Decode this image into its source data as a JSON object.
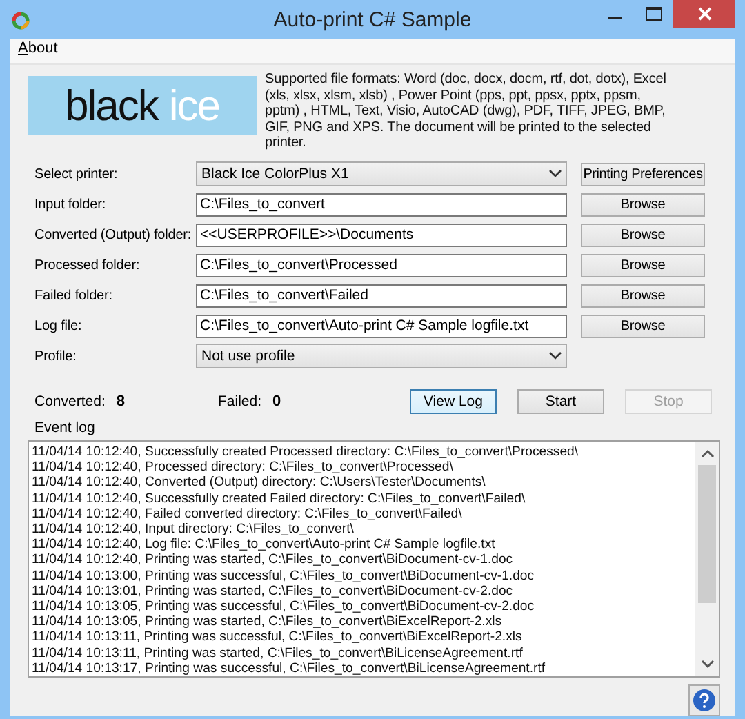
{
  "window": {
    "title": "Auto-print C# Sample"
  },
  "menu": [
    {
      "label": "About"
    }
  ],
  "logo": {
    "words": [
      "black",
      "ice"
    ]
  },
  "description": "Supported file formats: Word (doc, docx, docm, rtf, dot, dotx), Excel (xls, xlsx, xlsm, xlsb) , Power Point (pps, ppt, ppsx, pptx, ppsm, pptm) , HTML, Text, Visio, AutoCAD (dwg), PDF,  TIFF, JPEG, BMP, GIF, PNG and XPS. The document will be printed to the selected printer.",
  "fields": [
    {
      "kind": "dropdown",
      "label": "Select printer:",
      "value": "Black Ice ColorPlus X1",
      "button": "Printing Preferences"
    },
    {
      "kind": "text",
      "label": "Input folder:",
      "value": "C:\\Files_to_convert",
      "button": "Browse"
    },
    {
      "kind": "text",
      "label": "Converted (Output) folder:",
      "value": "<<USERPROFILE>>\\Documents",
      "button": "Browse"
    },
    {
      "kind": "text",
      "label": "Processed folder:",
      "value": "C:\\Files_to_convert\\Processed",
      "button": "Browse"
    },
    {
      "kind": "text",
      "label": "Failed folder:",
      "value": "C:\\Files_to_convert\\Failed",
      "button": "Browse"
    },
    {
      "kind": "text",
      "label": "Log file:",
      "value": "C:\\Files_to_convert\\Auto-print C# Sample logfile.txt",
      "button": "Browse"
    },
    {
      "kind": "dropdown",
      "label": "Profile:",
      "value": "Not use profile"
    }
  ],
  "stats": [
    {
      "label": "Converted:",
      "value": "8"
    },
    {
      "label": "Failed:",
      "value": "0"
    }
  ],
  "actions": [
    {
      "label": "View Log",
      "disabled": false,
      "focused": true
    },
    {
      "label": "Start",
      "disabled": false,
      "focused": false
    },
    {
      "label": "Stop",
      "disabled": true,
      "focused": false
    }
  ],
  "event_log": {
    "label": "Event log",
    "lines": [
      "11/04/14 10:12:40, Successfully created Processed directory: C:\\Files_to_convert\\Processed\\",
      "11/04/14 10:12:40, Processed directory: C:\\Files_to_convert\\Processed\\",
      "11/04/14 10:12:40, Converted (Output) directory: C:\\Users\\Tester\\Documents\\",
      "11/04/14 10:12:40, Successfully created Failed directory: C:\\Files_to_convert\\Failed\\",
      "11/04/14 10:12:40, Failed converted directory: C:\\Files_to_convert\\Failed\\",
      "11/04/14 10:12:40, Input directory: C:\\Files_to_convert\\",
      "11/04/14 10:12:40, Log file: C:\\Files_to_convert\\Auto-print C# Sample logfile.txt",
      "11/04/14 10:12:40, Printing was started, C:\\Files_to_convert\\BiDocument-cv-1.doc",
      "11/04/14 10:13:00, Printing was successful, C:\\Files_to_convert\\BiDocument-cv-1.doc",
      "11/04/14 10:13:01, Printing was started, C:\\Files_to_convert\\BiDocument-cv-2.doc",
      "11/04/14 10:13:05, Printing was successful, C:\\Files_to_convert\\BiDocument-cv-2.doc",
      "11/04/14 10:13:05, Printing was started, C:\\Files_to_convert\\BiExcelReport-2.xls",
      "11/04/14 10:13:11, Printing was successful, C:\\Files_to_convert\\BiExcelReport-2.xls",
      "11/04/14 10:13:11, Printing was started, C:\\Files_to_convert\\BiLicenseAgreement.rtf",
      "11/04/14 10:13:17, Printing was successful, C:\\Files_to_convert\\BiLicenseAgreement.rtf"
    ]
  }
}
